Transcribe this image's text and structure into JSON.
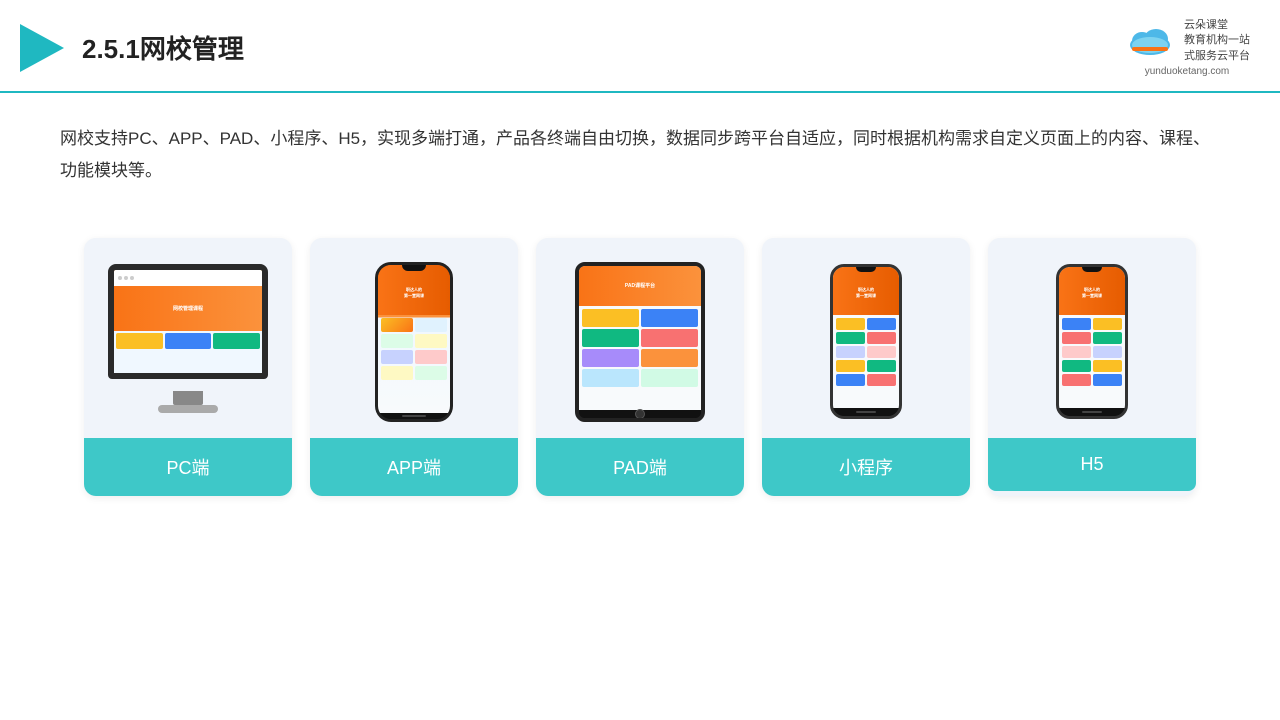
{
  "header": {
    "title": "2.5.1网校管理",
    "logo_name": "云朵课堂",
    "logo_tagline1": "教育机构一站",
    "logo_tagline2": "式服务云平台",
    "logo_domain": "yunduoketang.com"
  },
  "description": {
    "text": "网校支持PC、APP、PAD、小程序、H5，实现多端打通，产品各终端自由切换，数据同步跨平台自适应，同时根据机构需求自定义页面上的内容、课程、功能模块等。"
  },
  "cards": [
    {
      "id": "pc",
      "label": "PC端"
    },
    {
      "id": "app",
      "label": "APP端"
    },
    {
      "id": "pad",
      "label": "PAD端"
    },
    {
      "id": "miniprogram",
      "label": "小程序"
    },
    {
      "id": "h5",
      "label": "H5"
    }
  ],
  "colors": {
    "accent": "#3ec8c8",
    "header_border": "#1fb8c1",
    "card_bg": "#f0f4fa",
    "text_dark": "#222222",
    "text_body": "#333333"
  }
}
